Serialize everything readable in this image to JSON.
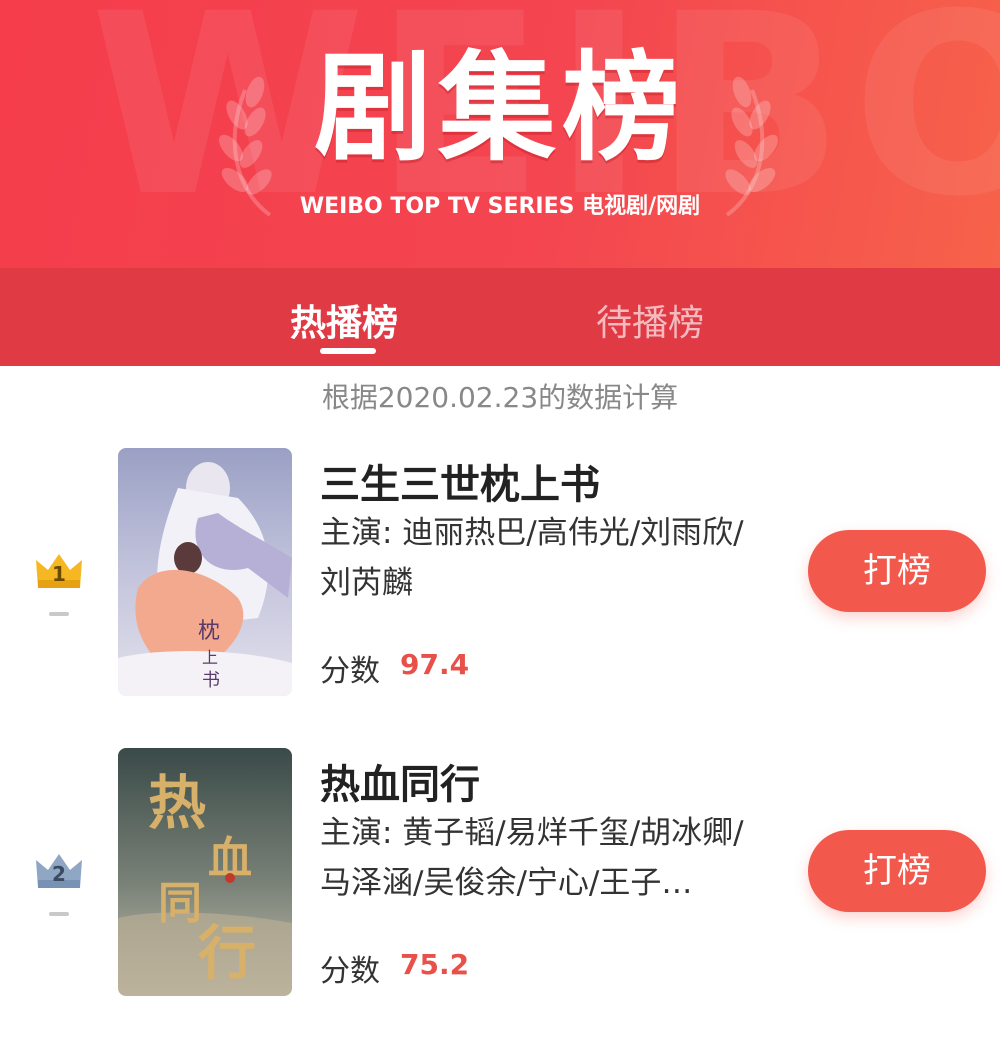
{
  "banner": {
    "watermark": "WEIBO",
    "title": "剧集榜",
    "subtitle": "WEIBO TOP TV SERIES 电视剧/网剧"
  },
  "tabs": [
    {
      "label": "热播榜",
      "active": true
    },
    {
      "label": "待播榜",
      "active": false
    }
  ],
  "date_note": "根据2020.02.23的数据计算",
  "rows": [
    {
      "rank": "1",
      "crown": "gold-crown-icon",
      "title": "三生三世枕上书",
      "cast": "主演: 迪丽热巴/高伟光/刘雨欣/刘芮麟",
      "score_label": "分数",
      "score": "97.4",
      "button": "打榜"
    },
    {
      "rank": "2",
      "crown": "silver-crown-icon",
      "title": "热血同行",
      "cast": "主演: 黄子韬/易烊千玺/胡冰卿/马泽涵/吴俊余/宁心/王子…",
      "score_label": "分数",
      "score": "75.2",
      "button": "打榜"
    }
  ],
  "colors": {
    "banner": "#f44550",
    "tabs_bg": "#e03a45",
    "accent": "#f2584c",
    "score": "#e8504a",
    "gold": "#f5b823",
    "silver": "#8fa6c4"
  }
}
